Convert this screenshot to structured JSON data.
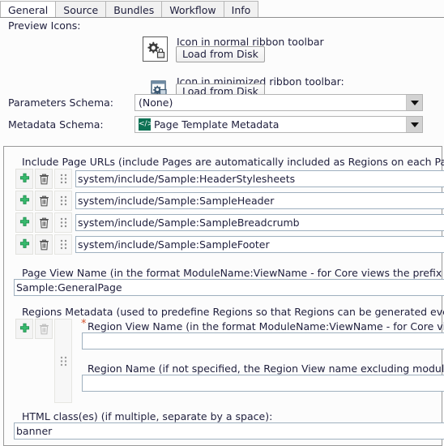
{
  "tabs": [
    {
      "label": "General",
      "active": true
    },
    {
      "label": "Source",
      "active": false
    },
    {
      "label": "Bundles",
      "active": false
    },
    {
      "label": "Workflow",
      "active": false
    },
    {
      "label": "Info",
      "active": false
    }
  ],
  "upper": {
    "preview_icons_label": "Preview Icons:",
    "normal_ribbon_label": "Icon in normal ribbon toolbar",
    "normal_ribbon_button": "Load from Disk",
    "minimized_ribbon_label": "Icon in minimized ribbon toolbar:",
    "minimized_ribbon_button": "Load from Disk",
    "parameters_schema_label": "Parameters Schema:",
    "parameters_schema_value": "(None)",
    "metadata_schema_label": "Metadata Schema:",
    "metadata_schema_value": "Page Template Metadata",
    "metadata_schema_badge": "</>",
    "normal_ribbon_icon": "gear-lock-icon",
    "minimized_ribbon_icon": "window-gear-icon"
  },
  "panel": {
    "include_page_urls_label": "Include Page URLs (include Pages are automatically included as Regions on each Page based o",
    "include_rows": [
      {
        "value": "system/include/Sample:HeaderStylesheets"
      },
      {
        "value": "system/include/Sample:SampleHeader"
      },
      {
        "value": "system/include/Sample:SampleBreadcrumb"
      },
      {
        "value": "system/include/Sample:SampleFooter"
      }
    ],
    "page_view_name_label": "Page View Name (in the format ModuleName:ViewName - for Core views the prefix can be om",
    "page_view_name_value": "Sample:GeneralPage",
    "regions_metadata_label": "Regions Metadata (used to predefine Regions so that Regions can be generated even if they a",
    "region_view_name_label": "Region View Name (in the format ModuleName:ViewName - for Core views the p",
    "region_view_name_required": "*",
    "region_view_name_value": "",
    "region_name_label": "Region Name (if not specified, the Region View name excluding module name is",
    "region_name_value": "",
    "html_classes_label": "HTML class(es) (if multiple, separate by a space):",
    "html_classes_value": "banner",
    "add_icon": "plus-icon",
    "delete_icon": "trash-icon",
    "drag_icon": "drag-handle-icon"
  },
  "colors": {
    "accent_green": "#2eb869",
    "badge_green": "#0d7254",
    "required_red": "#d4502a",
    "panel_border": "#9a9a9a",
    "field_border": "#9fb0bf"
  }
}
